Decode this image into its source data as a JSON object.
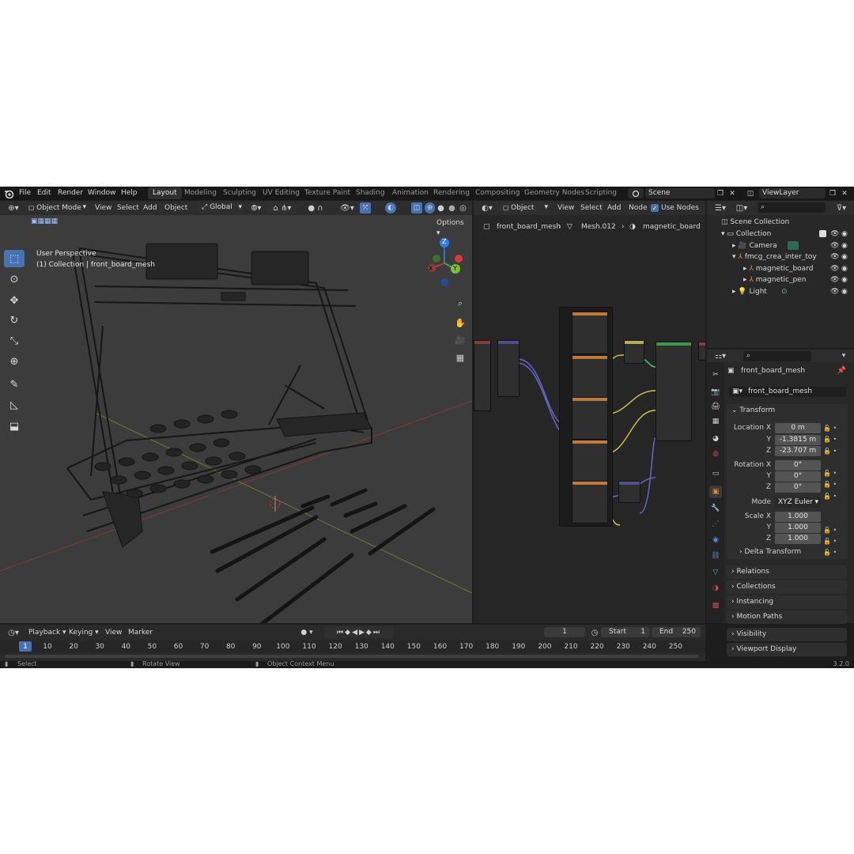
{
  "topbar": {
    "menus": [
      "File",
      "Edit",
      "Render",
      "Window",
      "Help"
    ],
    "workspaces": [
      "Layout",
      "Modeling",
      "Sculpting",
      "UV Editing",
      "Texture Paint",
      "Shading",
      "Animation",
      "Rendering",
      "Compositing",
      "Geometry Nodes",
      "Scripting"
    ],
    "active_workspace": "Layout",
    "scene": "Scene",
    "view_layer": "ViewLayer"
  },
  "viewport": {
    "mode": "Object Mode",
    "menus": [
      "View",
      "Select",
      "Add",
      "Object"
    ],
    "orientation": "Global",
    "options": "Options",
    "title": "User Perspective",
    "subtitle": "(1) Collection | front_board_mesh",
    "gizmo": {
      "x": "X",
      "y": "Y",
      "z": "Z"
    }
  },
  "node_editor": {
    "type": "Object",
    "menus": [
      "View",
      "Select",
      "Add",
      "Node"
    ],
    "use_nodes": "Use Nodes",
    "breadcrumb": [
      "front_board_mesh",
      "Mesh.012",
      "magnetic_board"
    ]
  },
  "outliner": {
    "root": "Scene Collection",
    "collection": "Collection",
    "items": [
      {
        "label": "Camera",
        "icon": "camera-icon"
      },
      {
        "label": "fmcg_crea_inter_toy",
        "icon": "empty-icon"
      },
      {
        "label": "magnetic_board",
        "icon": "empty-icon"
      },
      {
        "label": "magnetic_pen",
        "icon": "empty-icon"
      },
      {
        "label": "Light",
        "icon": "light-icon"
      }
    ]
  },
  "properties": {
    "object_name": "front_board_mesh",
    "data_name": "front_board_mesh",
    "transform_label": "Transform",
    "location_label": "Location X",
    "location": [
      "0 m",
      "-1.3815 m",
      "-23.707 m"
    ],
    "rotation_label": "Rotation X",
    "rotation": [
      "0°",
      "0°",
      "0°"
    ],
    "mode_label": "Mode",
    "mode": "XYZ Euler",
    "scale_label": "Scale X",
    "scale": [
      "1.000",
      "1.000",
      "1.000"
    ],
    "axis_y": "Y",
    "axis_z": "Z",
    "delta": "Delta Transform",
    "panels": [
      "Relations",
      "Collections",
      "Instancing",
      "Motion Paths",
      "Visibility",
      "Viewport Display"
    ]
  },
  "timeline": {
    "menus": [
      "Playback",
      "Keying",
      "View",
      "Marker"
    ],
    "current_frame": "1",
    "start_label": "Start",
    "start": "1",
    "end_label": "End",
    "end": "250",
    "ticks": [
      "1",
      "10",
      "20",
      "30",
      "40",
      "50",
      "60",
      "70",
      "80",
      "90",
      "100",
      "110",
      "120",
      "130",
      "140",
      "150",
      "160",
      "170",
      "180",
      "190",
      "200",
      "210",
      "220",
      "230",
      "240",
      "250"
    ]
  },
  "statusbar": {
    "select": "Select",
    "rotate": "Rotate View",
    "context": "Object Context Menu",
    "version": "3.2.0"
  },
  "colors": {
    "accent": "#4772b3",
    "header": "#303030",
    "viewport": "#3d3d3d",
    "node_bg": "#262626"
  }
}
